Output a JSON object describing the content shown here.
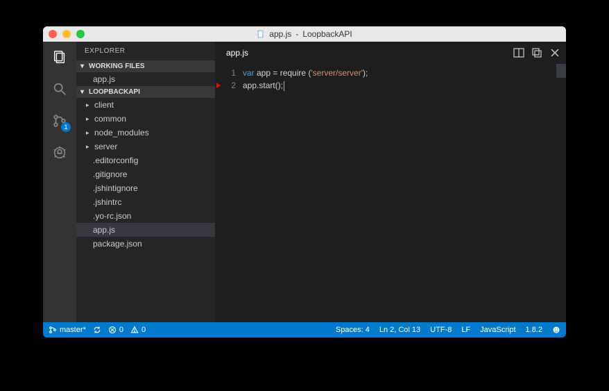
{
  "window": {
    "title_filename": "app.js",
    "title_project": "LoopbackAPI"
  },
  "activitybar": {
    "git_badge": "1"
  },
  "sidebar": {
    "title": "EXPLORER",
    "working_files": {
      "header": "WORKING FILES",
      "items": [
        "app.js"
      ]
    },
    "project": {
      "header": "LOOPBACKAPI",
      "folders": [
        "client",
        "common",
        "node_modules",
        "server"
      ],
      "files": [
        ".editorconfig",
        ".gitignore",
        ".jshintignore",
        ".jshintrc",
        ".yo-rc.json",
        "app.js",
        "package.json"
      ],
      "selected": "app.js"
    }
  },
  "editor": {
    "tab": "app.js",
    "lines": {
      "l1_kw": "var",
      "l1_rest1": " app = require (",
      "l1_str": "'server/server'",
      "l1_rest2": ");",
      "l2": "app.start();"
    },
    "line_numbers": [
      "1",
      "2"
    ]
  },
  "statusbar": {
    "branch": "master*",
    "errors": "0",
    "warnings": "0",
    "spaces": "Spaces: 4",
    "position": "Ln 2, Col 13",
    "encoding": "UTF-8",
    "eol": "LF",
    "language": "JavaScript",
    "version": "1.8.2"
  }
}
